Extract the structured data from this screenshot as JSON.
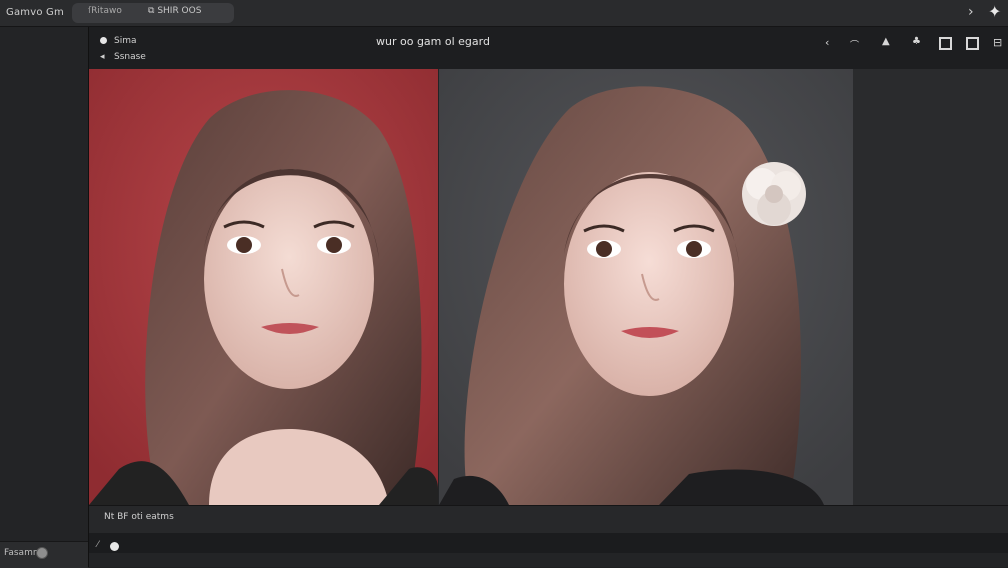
{
  "app": {
    "title": "Gamvo Gm"
  },
  "tabs": [
    {
      "label": "Ritawo",
      "icon": "F-icon"
    },
    {
      "label": "SHIR OOS",
      "icon": "copy-icon"
    }
  ],
  "topbar": {
    "forward_icon": "chevron-right-icon",
    "assist_icon": "sparkle-icon"
  },
  "panel": {
    "meta_line_1": "Sima",
    "meta_line_2": "Ssnase",
    "prompt_title": "wur oo gam ol egard"
  },
  "toolbar": {
    "icons": [
      "chevron-left-icon",
      "undo-icon",
      "triangle-icon",
      "adjust-icon",
      "frame-icon",
      "crop-square-icon",
      "split-view-icon"
    ]
  },
  "images": [
    {
      "description_icon": "portrait-red-background",
      "background": "#a7363b"
    },
    {
      "description_icon": "portrait-grey-background-with-flower",
      "background": "#46474a"
    }
  ],
  "caption": {
    "text": "Nt BF oti eatms"
  },
  "sidebar": {
    "bottom_label": "Fasamm"
  },
  "colors": {
    "accent_red": "#a7363b",
    "panel_bg": "#232426",
    "topbar_bg": "#2a2b2d"
  }
}
